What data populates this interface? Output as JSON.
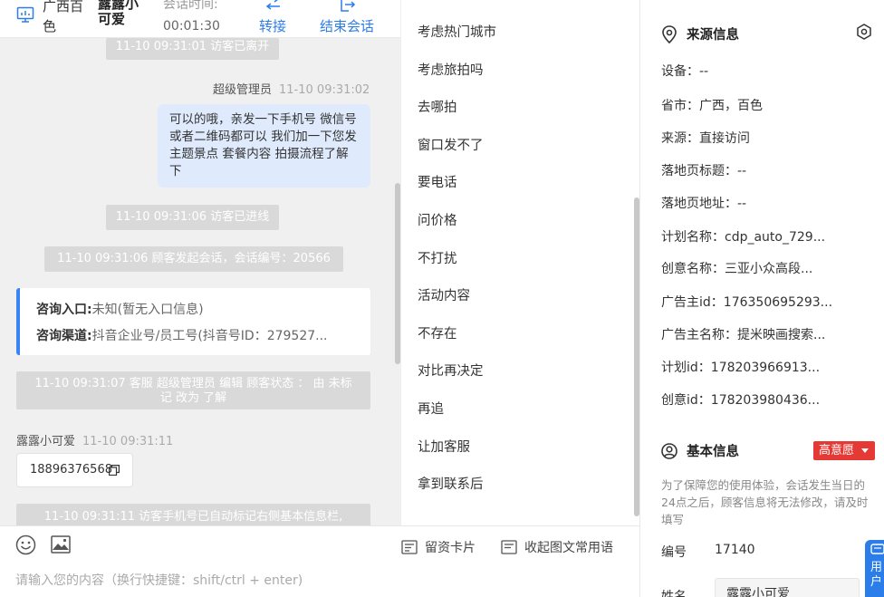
{
  "header": {
    "region": "广西百色",
    "visitor_name": "露露小可爱",
    "time_label": "会话时间:",
    "time_value": "00:01:30",
    "transfer_label": "转接",
    "end_label": "结束会话"
  },
  "chat": {
    "messages": [
      {
        "type": "system",
        "text": "11-10 09:31:01 访客已离开"
      },
      {
        "type": "agent_meta",
        "sender": "超级管理员",
        "time": "11-10 09:31:02"
      },
      {
        "type": "agent_bubble",
        "text": "可以的哦，亲发一下手机号 微信号或者二维码都可以 我们加一下您发主题景点 套餐内容 拍摄流程了解下"
      },
      {
        "type": "system",
        "text": "11-10 09:31:06 访客已进线"
      },
      {
        "type": "system",
        "text": "11-10 09:31:06 顾客发起会话，会话编号：20566"
      },
      {
        "type": "system",
        "text": "11-10 09:31:07 客服 超级管理员 编辑 顾客状态 ： 由 未标记 改为 了解"
      },
      {
        "type": "visitor_meta",
        "sender": "露露小可爱",
        "time": "11-10 09:31:11"
      },
      {
        "type": "visitor_bubble",
        "text": "18896376568"
      },
      {
        "type": "system",
        "text": "11-10 09:31:11 访客手机号已自动标记右侧基本信息栏,"
      }
    ],
    "info_card": {
      "entry_label": "咨询入口:",
      "entry_value": "未知(暂无入口信息)",
      "channel_label": "咨询渠道:",
      "channel_value": "抖音企业号/员工号(抖音号ID：279527..."
    }
  },
  "input": {
    "placeholder": "请输入您的内容（换行快捷键：shift/ctrl + enter)",
    "card_label": "留资卡片",
    "phrase_label": "收起图文常用语"
  },
  "phrases": {
    "items": [
      "考虑热门城市",
      "考虑旅拍吗",
      "去哪拍",
      "窗口发不了",
      "要电话",
      "问价格",
      "不打扰",
      "活动内容",
      "不存在",
      "对比再决定",
      "再追",
      "让加客服",
      "拿到联系后"
    ]
  },
  "source_info": {
    "title": "来源信息",
    "rows": [
      {
        "label": "设备：",
        "value": "--"
      },
      {
        "label": "省市：",
        "value": "广西，百色"
      },
      {
        "label": "来源：",
        "value": "直接访问"
      },
      {
        "label": "落地页标题：",
        "value": "--"
      },
      {
        "label": "落地页地址：",
        "value": "--"
      },
      {
        "label": "计划名称：",
        "value": "cdp_auto_729..."
      },
      {
        "label": "创意名称：",
        "value": "三亚小众高段..."
      },
      {
        "label": "广告主id：",
        "value": "176350695293..."
      },
      {
        "label": "广告主名称：",
        "value": "提米映画搜索..."
      },
      {
        "label": "计划id：",
        "value": "178203966913..."
      },
      {
        "label": "创意id：",
        "value": "178203980436..."
      }
    ]
  },
  "basic_info": {
    "title": "基本信息",
    "intent_badge": "高意愿",
    "notice": "为了保障您的使用体验，会话发生当日的24点之后，顾客信息将无法修改，请及时填写",
    "id_label": "编号",
    "id_value": "17140",
    "name_label": "姓名",
    "name_value": "露露小可爱",
    "float_help": "用户"
  },
  "colors": {
    "accent": "#2b7de9",
    "agent_bubble": "#dfebfd",
    "system_pill": "#d9d9d9",
    "badge_red": "#e53935"
  }
}
